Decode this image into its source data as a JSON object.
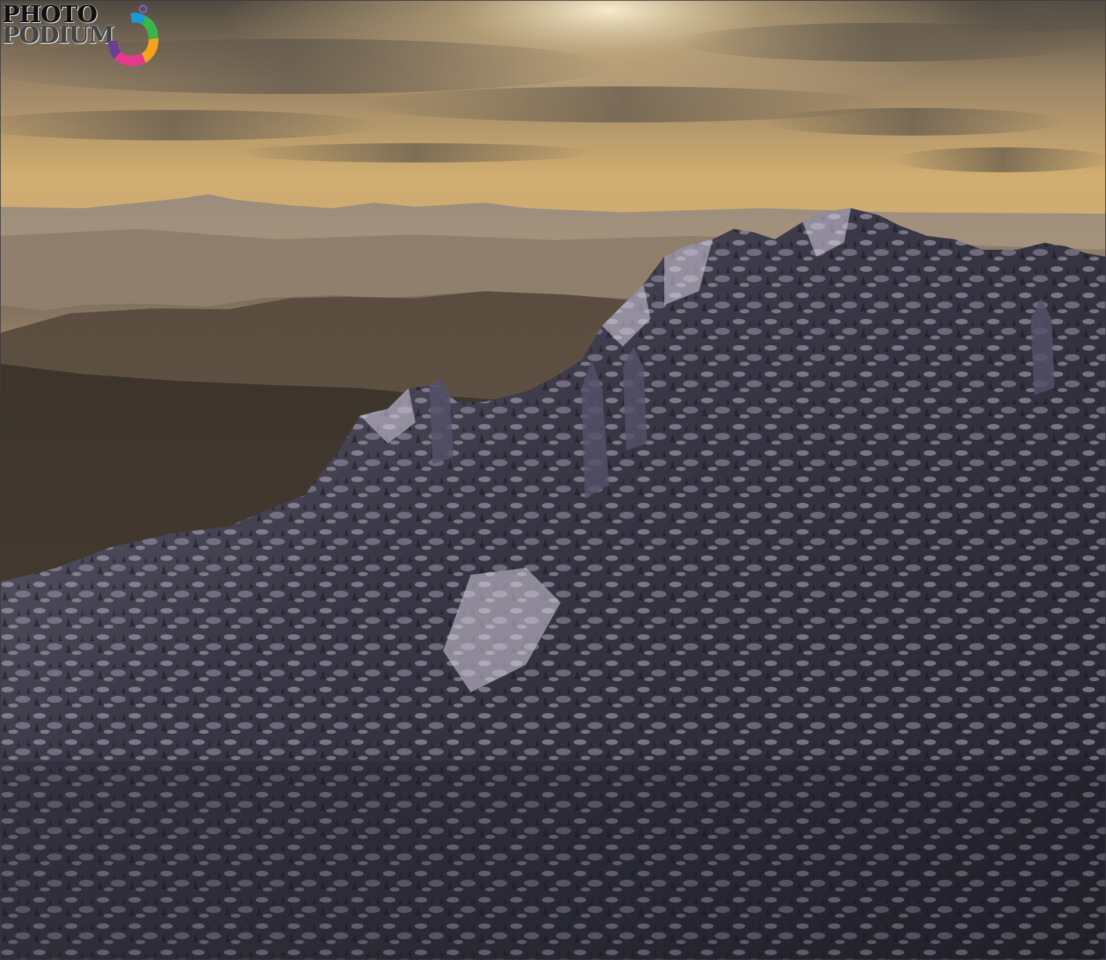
{
  "logo": {
    "line1": "PHOTO",
    "line2": "PODIUM"
  },
  "colors": {
    "sky_top": "#5b5346",
    "sky_glow": "#f2d9a6",
    "sky_low": "#c9a66a",
    "far_ridge": "#8d7d6d",
    "mid_ridge": "#6e5f52",
    "forest": "#3c352f",
    "rock": "#2e2d3a",
    "snow": "#b7b0c4"
  },
  "scene": {
    "icon": "mountain-landscape"
  }
}
